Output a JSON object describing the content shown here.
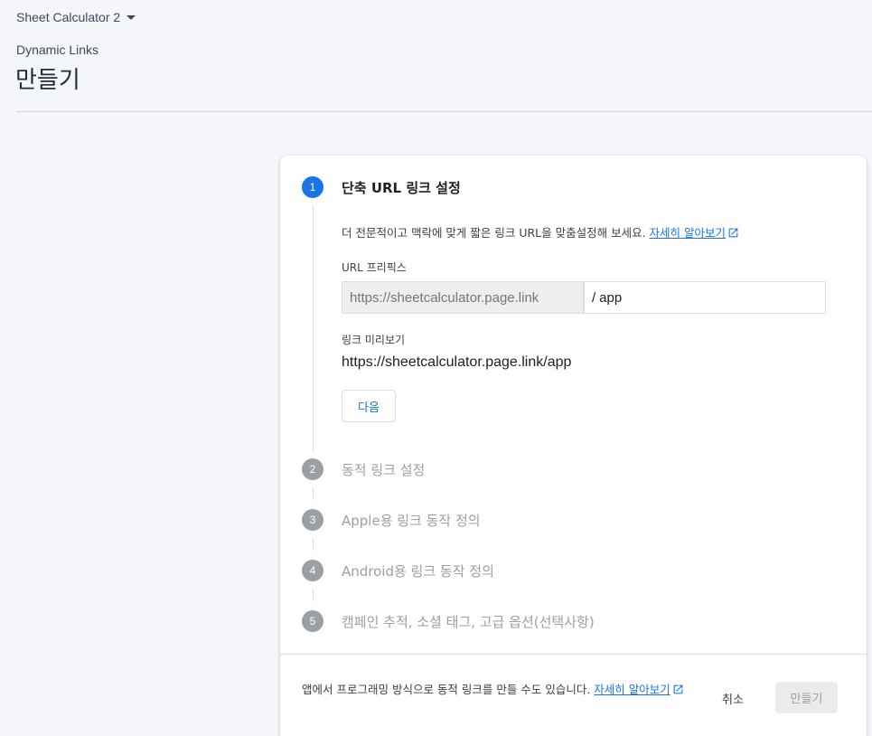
{
  "project": {
    "name": "Sheet Calculator 2"
  },
  "header": {
    "breadcrumb": "Dynamic Links",
    "title": "만들기"
  },
  "steps": [
    {
      "number": "1",
      "title": "단축 URL 링크 설정",
      "active": true
    },
    {
      "number": "2",
      "title": "동적 링크 설정",
      "active": false
    },
    {
      "number": "3",
      "title": "Apple용 링크 동작 정의",
      "active": false
    },
    {
      "number": "4",
      "title": "Android용 링크 동작 정의",
      "active": false
    },
    {
      "number": "5",
      "title": "캠페인 추적, 소셜 태그, 고급 옵션(선택사항)",
      "active": false
    }
  ],
  "step1": {
    "description": "더 전문적이고 맥락에 맞게 짧은 링크 URL을 맞춤설정해 보세요.",
    "learn_more": "자세히 알아보기",
    "prefix_label": "URL 프리픽스",
    "prefix_placeholder": "https://sheetcalculator.page.link",
    "suffix_slash": "/",
    "suffix_value": "app",
    "preview_label": "링크 미리보기",
    "preview_value": "https://sheetcalculator.page.link/app",
    "next_label": "다음"
  },
  "footer": {
    "text": "앱에서 프로그래밍 방식으로 동적 링크를 만들 수도 있습니다.",
    "learn_more": "자세히 알아보기",
    "cancel_label": "취소",
    "create_label": "만들기"
  },
  "colors": {
    "accent": "#1a73e8",
    "inactive": "#9aa0a6"
  },
  "icons": {
    "dropdown": "caret-down-icon",
    "external": "open-in-new-icon"
  }
}
